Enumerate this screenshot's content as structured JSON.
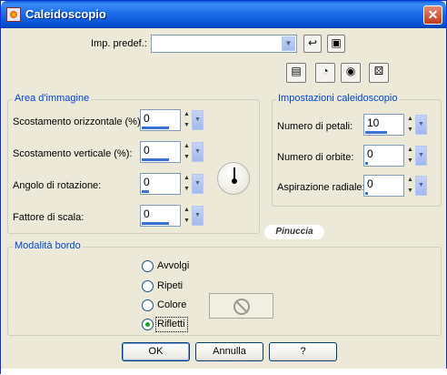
{
  "window": {
    "title": "Caleidoscopio",
    "close_glyph": "✕"
  },
  "preset": {
    "label": "Imp. predef.:",
    "value": ""
  },
  "toolbar_icons": [
    "save-preset-icon",
    "reset-icon",
    "preview-on-icon",
    "preview-off-icon",
    "randomize-icon"
  ],
  "image_area": {
    "title": "Area d'immagine",
    "fields": [
      {
        "label": "Scostamento orizzontale (%):",
        "value": "0"
      },
      {
        "label": "Scostamento verticale (%):",
        "value": "0"
      },
      {
        "label": "Angolo di rotazione:",
        "value": "0"
      },
      {
        "label": "Fattore di scala:",
        "value": "0"
      }
    ]
  },
  "kaleido_settings": {
    "title": "Impostazioni caleidoscopio",
    "fields": [
      {
        "label": "Numero di petali:",
        "value": "10",
        "bar_fraction": 0.55
      },
      {
        "label": "Numero di orbite:",
        "value": "0",
        "bar_fraction": 0.05
      },
      {
        "label": "Aspirazione radiale:",
        "value": "0",
        "bar_fraction": 0.05
      }
    ]
  },
  "edge_mode": {
    "title": "Modalità bordo",
    "options": [
      {
        "label": "Avvolgi",
        "checked": false
      },
      {
        "label": "Ripeti",
        "checked": false
      },
      {
        "label": "Colore",
        "checked": false
      },
      {
        "label": "Rifletti",
        "checked": true
      }
    ]
  },
  "watermark": "Pinuccia",
  "buttons": {
    "ok": "OK",
    "cancel": "Annulla",
    "help": "?"
  },
  "colors": {
    "title_bar": "#0a5fd8",
    "face": "#ece9d8",
    "group_title": "#0046d5",
    "value_bar": "#3a6fd4"
  }
}
